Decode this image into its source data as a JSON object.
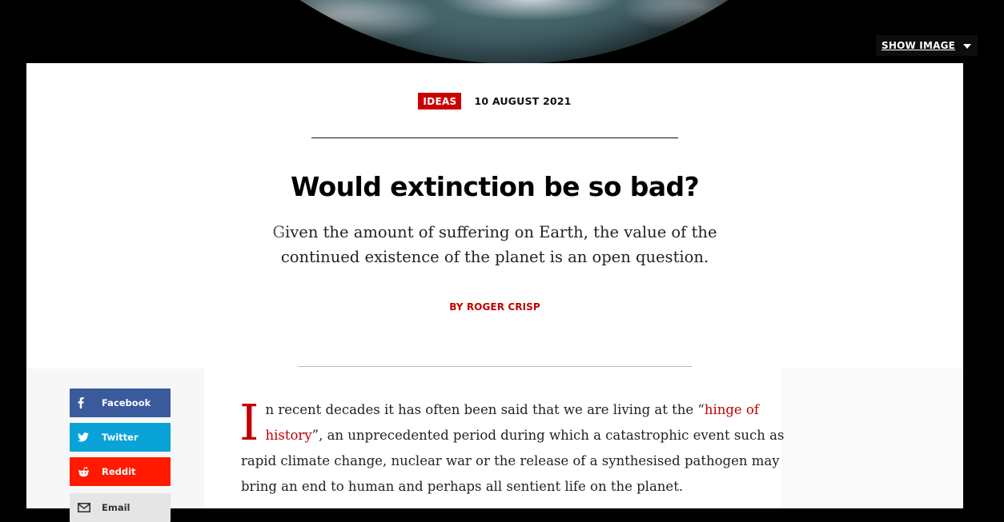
{
  "hero": {
    "show_image_label": "SHOW IMAGE"
  },
  "article": {
    "tag": "IDEAS",
    "date": "10 AUGUST 2021",
    "headline": "Would extinction be so bad?",
    "standfirst_first_letter": "G",
    "standfirst_rest": "iven the amount of suffering on Earth, the value of the continued existence of the planet is an open question.",
    "byline": "BY ROGER CRISP",
    "body": {
      "dropcap": "I",
      "before_link": "n recent decades it has often been said that we are living at the “",
      "link_text": "hinge of history",
      "after_link": "”, an unprecedented period during which a catastrophic event such as rapid climate change, nuclear war or the release of a synthesised pathogen may bring an end to human and perhaps all sentient life on the planet."
    }
  },
  "share": [
    {
      "label": "Facebook",
      "icon": "facebook-icon",
      "color": "#3a5a9b"
    },
    {
      "label": "Twitter",
      "icon": "twitter-icon",
      "color": "#0aa3d7"
    },
    {
      "label": "Reddit",
      "icon": "reddit-icon",
      "color": "#ff1a00"
    },
    {
      "label": "Email",
      "icon": "email-icon",
      "color": "#e5e5e5"
    }
  ],
  "colors": {
    "accent": "#c00000",
    "tag_bg": "#cc0000"
  }
}
